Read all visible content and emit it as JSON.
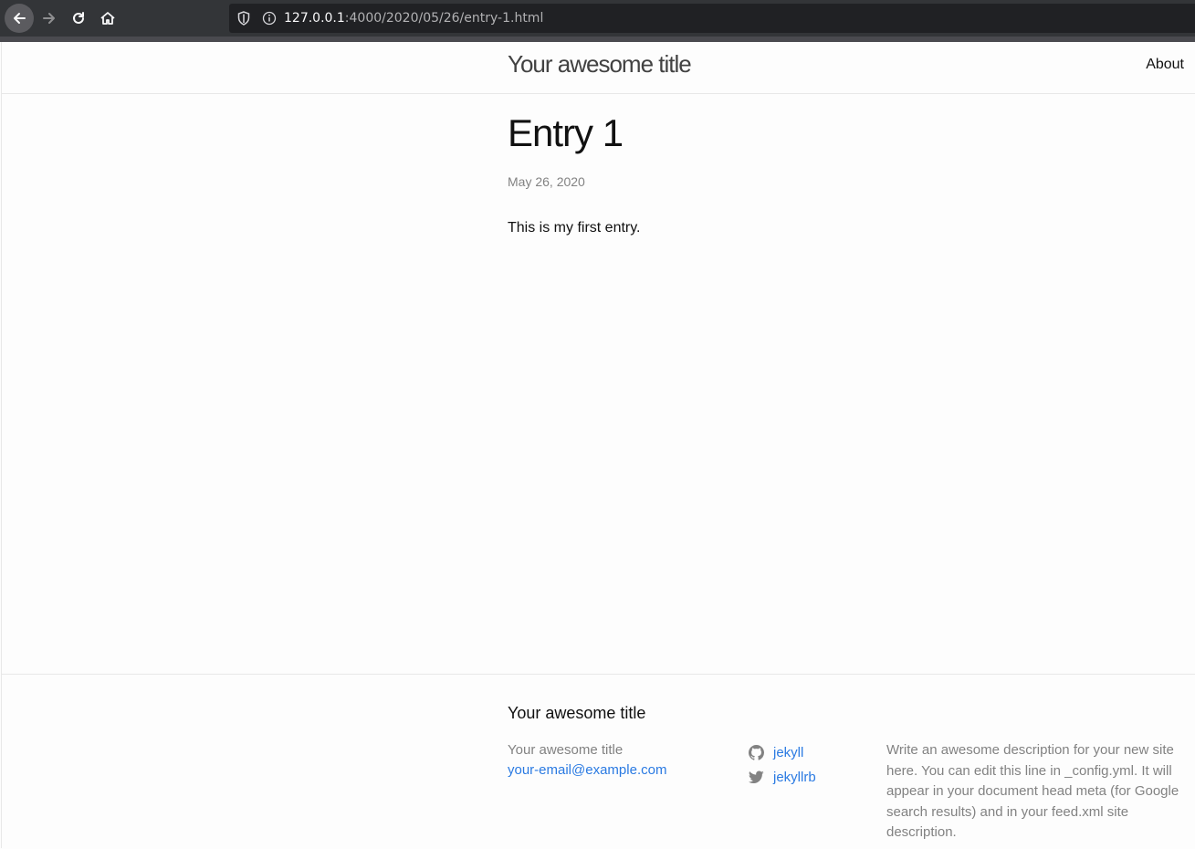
{
  "browser": {
    "url_host": "127.0.0.1",
    "url_rest": ":4000/2020/05/26/entry-1.html"
  },
  "header": {
    "site_title": "Your awesome title",
    "nav_about": "About"
  },
  "post": {
    "title": "Entry 1",
    "date": "May 26, 2020",
    "content": "This is my first entry."
  },
  "footer": {
    "heading": "Your awesome title",
    "name": "Your awesome title",
    "email": "your-email@example.com",
    "social": [
      {
        "label": "jekyll",
        "icon": "github-icon"
      },
      {
        "label": "jekyllrb",
        "icon": "twitter-icon"
      }
    ],
    "description": "Write an awesome description for your new site here. You can edit this line in _config.yml. It will appear in your document head meta (for Google search results) and in your feed.xml site description."
  }
}
